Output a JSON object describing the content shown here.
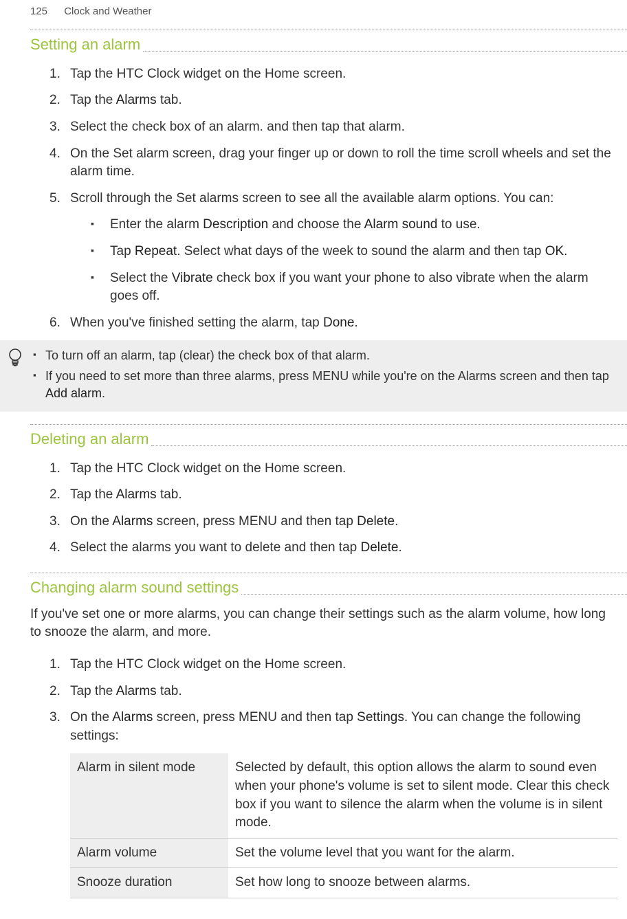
{
  "header": {
    "page_number": "125",
    "chapter": "Clock and Weather"
  },
  "sections": {
    "setting": {
      "title": "Setting an alarm",
      "steps": [
        {
          "num": "1.",
          "text": "Tap the HTC Clock widget on the Home screen."
        },
        {
          "num": "2.",
          "pre": "Tap the ",
          "bold": "Alarms",
          "post": " tab."
        },
        {
          "num": "3.",
          "text": "Select the check box of an alarm. and then tap that alarm."
        },
        {
          "num": "4.",
          "text": "On the Set alarm screen, drag your finger up or down to roll the time scroll wheels and set the alarm time."
        },
        {
          "num": "5.",
          "text": "Scroll through the Set alarms screen to see all the available alarm options. You can:"
        },
        {
          "num": "6.",
          "pre": "When you've finished setting the alarm, tap ",
          "bold": "Done",
          "post": "."
        }
      ],
      "bullets": [
        {
          "p1": "Enter the alarm ",
          "b1": "Description",
          "p2": " and choose the ",
          "b2": "Alarm sound",
          "p3": " to use."
        },
        {
          "p1": "Tap ",
          "b1": "Repeat",
          "p2": ". Select what days of the week to sound the alarm and then tap ",
          "b2": "OK",
          "p3": "."
        },
        {
          "p1": "Select the ",
          "b1": "Vibrate",
          "p2": " check box if you want your phone to also vibrate when the alarm goes off.",
          "b2": "",
          "p3": ""
        }
      ],
      "tips": [
        "To turn off an alarm, tap (clear) the check box of that alarm.",
        "If you need to set more than three alarms, press MENU while you're on the Alarms screen and then tap "
      ],
      "tip_bold": "Add alarm",
      "tip_post": "."
    },
    "deleting": {
      "title": "Deleting an alarm",
      "steps": [
        {
          "num": "1.",
          "text": "Tap the HTC Clock widget on the Home screen."
        },
        {
          "num": "2.",
          "pre": "Tap the ",
          "bold": "Alarms",
          "post": " tab."
        },
        {
          "num": "3.",
          "pre": "On the ",
          "bold": "Alarms",
          "mid": " screen, press MENU and then tap ",
          "bold2": "Delete",
          "post": "."
        },
        {
          "num": "4.",
          "pre": "Select the alarms you want to delete and then tap ",
          "bold": "Delete",
          "post": "."
        }
      ]
    },
    "changing": {
      "title": "Changing alarm sound settings",
      "intro": "If you've set one or more alarms, you can change their settings such as the alarm volume, how long to snooze the alarm, and more.",
      "steps": [
        {
          "num": "1.",
          "text": "Tap the HTC Clock widget on the Home screen."
        },
        {
          "num": "2.",
          "pre": "Tap the ",
          "bold": "Alarms",
          "post": " tab."
        },
        {
          "num": "3.",
          "pre": "On the ",
          "bold": "Alarms",
          "mid": " screen, press MENU and then tap ",
          "bold2": "Settings",
          "post": ". You can change the following settings:"
        }
      ],
      "table": [
        {
          "name": "Alarm in silent mode",
          "desc": "Selected by default, this option allows the alarm to sound even when your phone's volume is set to silent mode. Clear this check box if you want to silence the alarm when the volume is in silent mode."
        },
        {
          "name": "Alarm volume",
          "desc": "Set the volume level that you want for the alarm."
        },
        {
          "name": "Snooze duration",
          "desc": "Set how long to snooze between alarms."
        }
      ]
    }
  }
}
